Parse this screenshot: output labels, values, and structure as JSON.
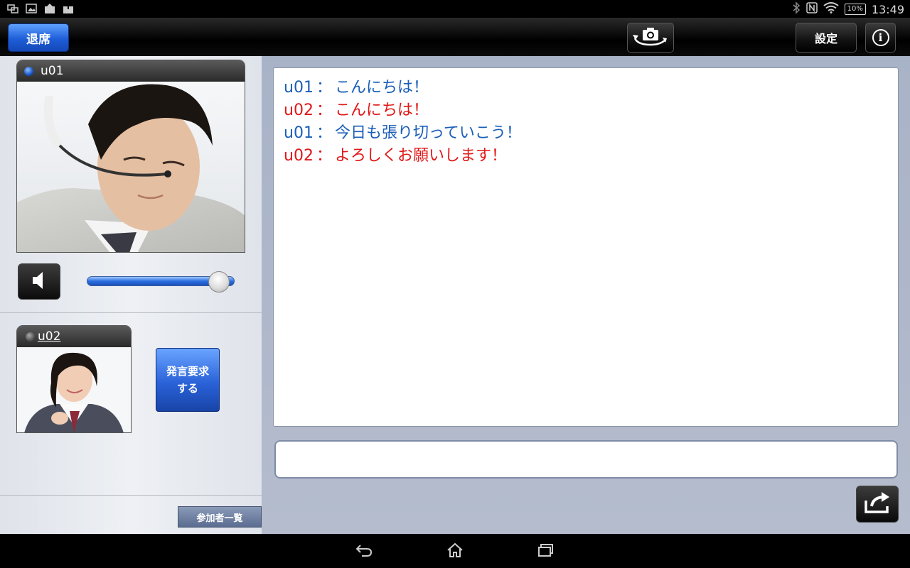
{
  "status_bar": {
    "time": "13:49",
    "battery": "10%",
    "icons": [
      "screen-mirror-icon",
      "gallery-icon",
      "upload-icon",
      "upload-alt-icon",
      "bluetooth-icon",
      "nfc-icon",
      "wifi-icon",
      "battery-icon"
    ]
  },
  "toolbar": {
    "leave_label": "退席",
    "settings_label": "設定",
    "camera_icon": "camera-switch-icon",
    "info_icon": "info-icon",
    "info_glyph": "i"
  },
  "participants": {
    "main": {
      "name": "u01",
      "status": "speaking"
    },
    "secondary": {
      "name": "u02",
      "status": "idle"
    }
  },
  "audio": {
    "volume": 0.9
  },
  "request_button_label": "発言要求する",
  "participants_list_label": "参加者一覧",
  "chat": {
    "messages": [
      {
        "speaker": "u01",
        "separator": "：",
        "text": "こんにちは！",
        "color": "#1a5eb8"
      },
      {
        "speaker": "u02",
        "separator": "：",
        "text": "こんにちは！",
        "color": "#e01818"
      },
      {
        "speaker": "u01",
        "separator": "：",
        "text": "今日も張り切っていこう！",
        "color": "#1a5eb8"
      },
      {
        "speaker": "u02",
        "separator": "：",
        "text": "よろしくお願いします！",
        "color": "#e01818"
      }
    ],
    "input_value": "",
    "input_placeholder": ""
  },
  "nav": {
    "icons": [
      "back-icon",
      "home-icon",
      "recent-apps-icon"
    ]
  },
  "colors": {
    "accent_blue": "#2a62d8",
    "speaker_blue": "#1a5eb8",
    "speaker_red": "#e01818"
  }
}
